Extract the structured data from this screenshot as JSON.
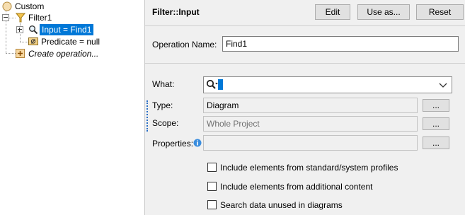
{
  "tree": {
    "root_label": "Custom",
    "filter_label": "Filter1",
    "input_label": "Input = Find1",
    "predicate_label": "Predicate = null",
    "create_label": "Create operation..."
  },
  "header": {
    "title": "Filter::Input",
    "edit_label": "Edit",
    "use_as_label": "Use as...",
    "reset_label": "Reset"
  },
  "form": {
    "operation_name_label": "Operation Name:",
    "operation_name_value": "Find1",
    "what_label": "What:",
    "type_label": "Type:",
    "type_value": "Diagram",
    "scope_label": "Scope:",
    "scope_value": "Whole Project",
    "properties_label": "Properties:",
    "properties_value": "",
    "dots_label": "...",
    "checkboxes": [
      {
        "label": "Include elements from standard/system profiles",
        "checked": false
      },
      {
        "label": "Include elements from additional content",
        "checked": false
      },
      {
        "label": "Search data unused in diagrams",
        "checked": false
      }
    ]
  },
  "colors": {
    "selection": "#0078d7",
    "panel_bg": "#f0f0f0",
    "info_icon": "#3a8dde"
  },
  "icons": [
    "root-package-icon",
    "filter-funnel-icon",
    "magnifier-icon",
    "predicate-icon",
    "add-operation-icon",
    "info-icon",
    "search-icon",
    "chevron-down-icon"
  ]
}
